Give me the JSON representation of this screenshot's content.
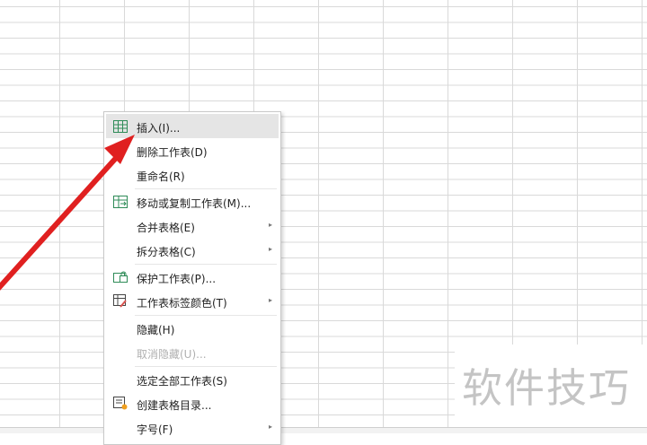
{
  "context_menu": {
    "items": [
      {
        "label": "插入(I)...",
        "icon": "insert-table-icon"
      },
      {
        "label": "删除工作表(D)"
      },
      {
        "label": "重命名(R)"
      },
      {
        "label": "移动或复制工作表(M)...",
        "icon": "move-copy-sheet-icon"
      },
      {
        "label": "合并表格(E)"
      },
      {
        "label": "拆分表格(C)"
      },
      {
        "label": "保护工作表(P)...",
        "icon": "protect-sheet-icon"
      },
      {
        "label": "工作表标签颜色(T)",
        "icon": "tab-color-icon"
      },
      {
        "label": "隐藏(H)"
      },
      {
        "label": "取消隐藏(U)..."
      },
      {
        "label": "选定全部工作表(S)"
      },
      {
        "label": "创建表格目录...",
        "icon": "create-toc-icon"
      },
      {
        "label": "字号(F)"
      }
    ]
  },
  "watermark": {
    "text": "软件技巧"
  },
  "colors": {
    "arrow": "#e02020",
    "hover": "#e5e5e5",
    "icon_green": "#2e8b57"
  }
}
